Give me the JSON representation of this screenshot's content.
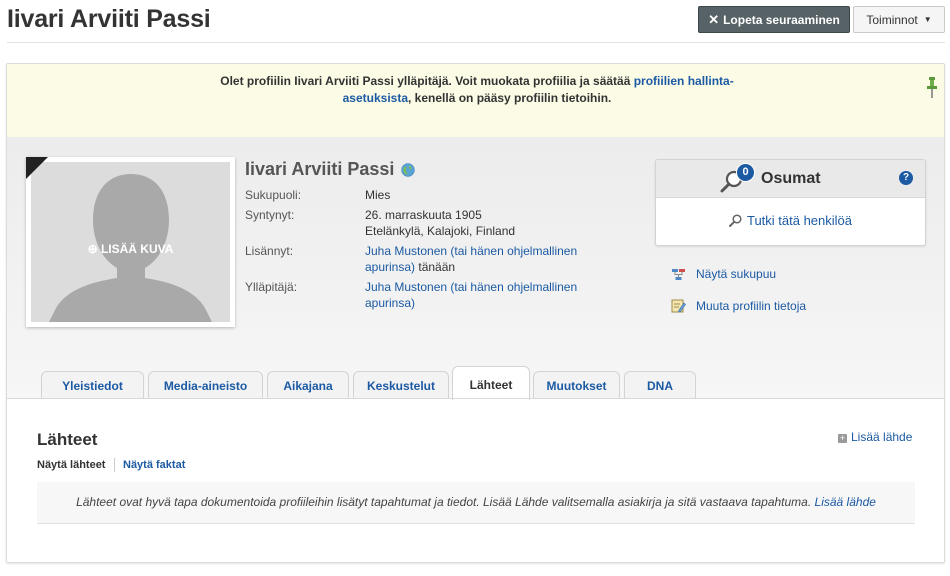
{
  "header": {
    "title": "Iivari Arviiti Passi",
    "unfollow_label": "Lopeta seuraaminen",
    "actions_label": "Toiminnot"
  },
  "notice": {
    "text_before": "Olet profiilin Iivari Arviiti Passi ylläpitäjä. Voit muokata profiilia ja säätää ",
    "link": "profiilien hallinta-asetuksista",
    "text_after": ", kenellä on pääsy profiilin tietoihin."
  },
  "profile": {
    "name": "Iivari Arviiti Passi",
    "add_photo_label": "LISÄÄ KUVA",
    "gender_label": "Sukupuoli:",
    "gender_value": "Mies",
    "born_label": "Syntynyt:",
    "born_date": "26. marraskuuta 1905",
    "born_place": "Etelänkylä, Kalajoki, Finland",
    "added_label": "Lisännyt:",
    "added_by": "Juha Mustonen (tai hänen ohjelmallinen apurinsa)",
    "added_when": " tänään",
    "manager_label": "Ylläpitäjä:",
    "manager": "Juha Mustonen (tai hänen ohjelmallinen apurinsa)"
  },
  "matches": {
    "count": "0",
    "title": "Osumat",
    "help": "?",
    "research_link": "Tutki tätä henkilöä"
  },
  "side_links": {
    "family_tree": "Näytä sukupuu",
    "edit_profile": "Muuta profiilin tietoja"
  },
  "tabs": [
    {
      "label": "Yleistiedot"
    },
    {
      "label": "Media-aineisto"
    },
    {
      "label": "Aikajana"
    },
    {
      "label": "Keskustelut"
    },
    {
      "label": "Lähteet",
      "active": true
    },
    {
      "label": "Muutokset"
    },
    {
      "label": "DNA"
    }
  ],
  "sources": {
    "title": "Lähteet",
    "add_label": "Lisää lähde",
    "view_sources": "Näytä lähteet",
    "view_facts": "Näytä faktat",
    "empty_text": "Lähteet ovat hyvä tapa dokumentoida profiileihin lisätyt tapahtumat ja tiedot. Lisää Lähde valitsemalla asiakirja ja sitä vastaava tapahtuma.",
    "empty_link": "Lisää lähde"
  },
  "colors": {
    "link": "#1c5aa3",
    "unfollow_bg": "#566266",
    "notice_bg": "#fbfbe6"
  }
}
